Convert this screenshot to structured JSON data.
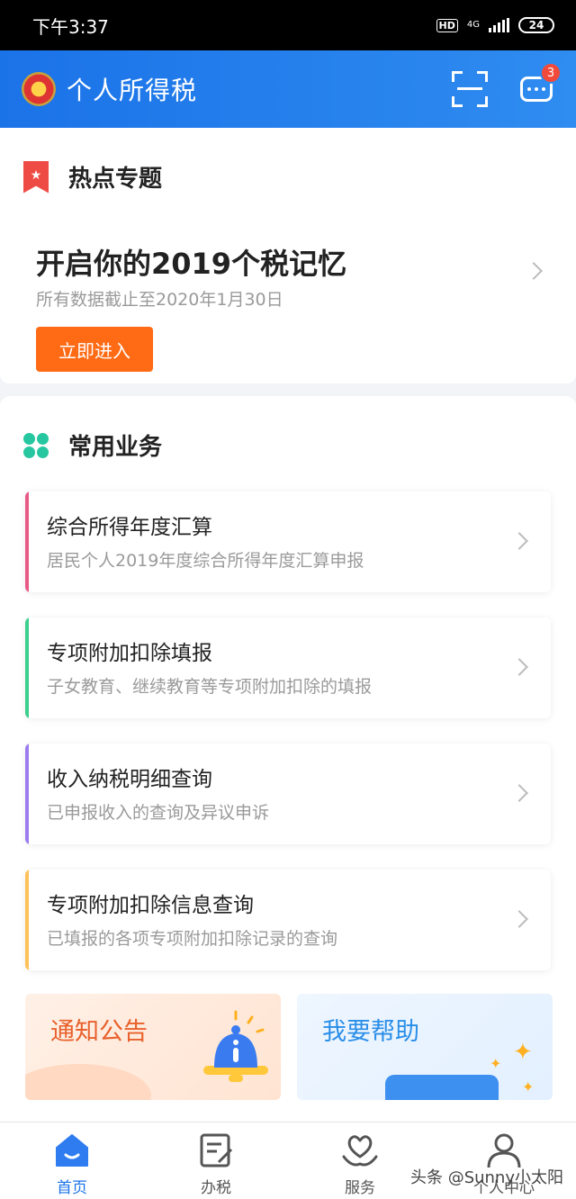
{
  "status_bar": {
    "time": "下午3:37",
    "hd": "HD",
    "network": "4G",
    "battery": "24"
  },
  "header": {
    "title": "个人所得税",
    "logo_icon": "national-emblem",
    "scan_icon": "scan-icon",
    "message_icon": "message-icon",
    "message_badge": "3"
  },
  "hot_topic": {
    "section_title": "热点专题",
    "section_icon": "bookmark-icon",
    "headline": "开启你的2019个税记忆",
    "subtitle": "所有数据截止至2020年1月30日",
    "button_label": "立即进入"
  },
  "services": {
    "section_title": "常用业务",
    "section_icon": "clover-icon",
    "items": [
      {
        "title": "综合所得年度汇算",
        "desc": "居民个人2019年度综合所得年度汇算申报",
        "accent": "#e85a86"
      },
      {
        "title": "专项附加扣除填报",
        "desc": "子女教育、继续教育等专项附加扣除的填报",
        "accent": "#3ccf8e"
      },
      {
        "title": "收入纳税明细查询",
        "desc": "已申报收入的查询及异议申诉",
        "accent": "#9b7cf0"
      },
      {
        "title": "专项附加扣除信息查询",
        "desc": "已填报的各项专项附加扣除记录的查询",
        "accent": "#ffc15a"
      }
    ]
  },
  "promos": {
    "notice": "通知公告",
    "help": "我要帮助"
  },
  "tabbar": {
    "items": [
      {
        "label": "首页",
        "icon": "home-icon",
        "active": true
      },
      {
        "label": "办税",
        "icon": "edit-doc-icon",
        "active": false
      },
      {
        "label": "服务",
        "icon": "heart-hand-icon",
        "active": false
      },
      {
        "label": "个人中心",
        "icon": "user-icon",
        "active": false
      }
    ]
  },
  "watermark": "头条 @Sunny小太阳",
  "colors": {
    "header_blue": "#1b73e8",
    "accent_orange": "#ff6a14",
    "bookmark_red": "#ef4b45",
    "clover_green": "#26c7a0"
  }
}
